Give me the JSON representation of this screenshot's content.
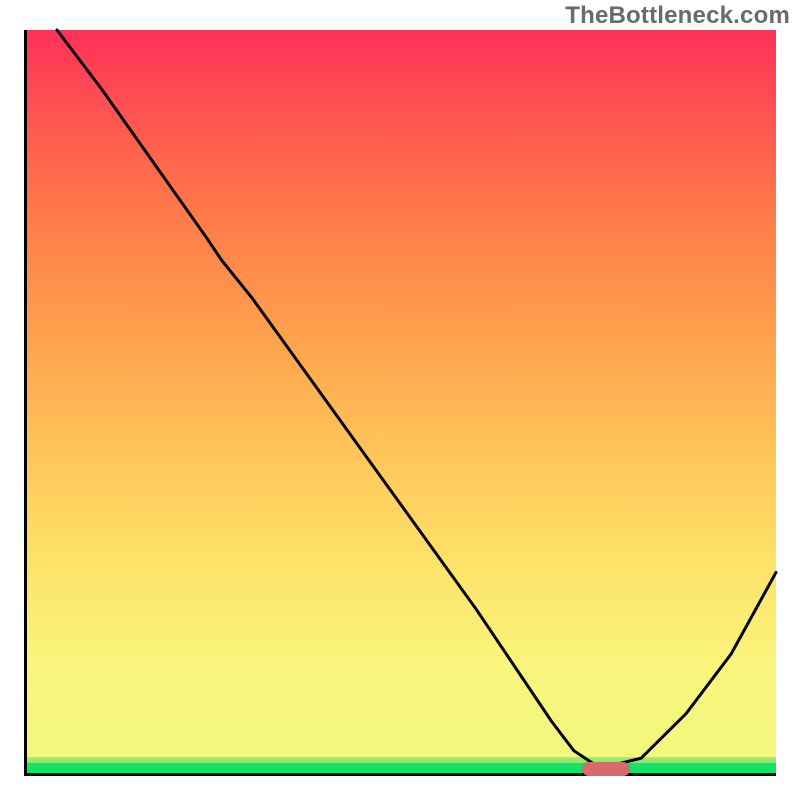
{
  "watermark": "TheBottleneck.com",
  "colors": {
    "gradient_top": "#ff2f59",
    "gradient_mid": "#ffc559",
    "gradient_yellow": "#faf57c",
    "gradient_green": "#13e26a",
    "curve": "#000000",
    "marker": "#d66a6d",
    "axis": "#000000"
  },
  "chart_data": {
    "type": "line",
    "title": "",
    "xlabel": "",
    "ylabel": "",
    "xlim": [
      0,
      100
    ],
    "ylim": [
      0,
      100
    ],
    "grid": false,
    "legend": false,
    "series": [
      {
        "name": "bottleneck-curve",
        "x": [
          4,
          10,
          17,
          24,
          26,
          30,
          40,
          50,
          60,
          66,
          70,
          73,
          76,
          78,
          82,
          88,
          94,
          100
        ],
        "y": [
          100,
          92,
          82,
          72,
          69,
          64,
          50,
          36,
          22,
          13,
          7,
          3,
          1,
          1,
          2,
          8,
          16,
          27
        ]
      }
    ],
    "annotations": [
      {
        "name": "optimal-marker",
        "x": 77,
        "y": 1,
        "width_percent": 6.5,
        "color": "#d66a6d"
      }
    ]
  }
}
